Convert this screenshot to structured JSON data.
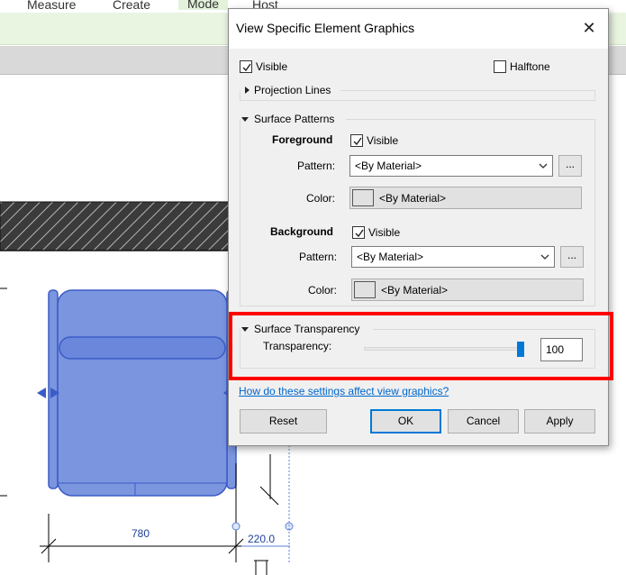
{
  "ribbon": {
    "tabs": [
      "Measure",
      "Create",
      "Mode",
      "Host"
    ],
    "active_tab": "Mode"
  },
  "drawing": {
    "dimension_width": "780",
    "dimension_offset": "220.0"
  },
  "dialog": {
    "title": "View Specific Element Graphics",
    "close_icon": "close-icon",
    "visible_label": "Visible",
    "visible_checked": true,
    "halftone_label": "Halftone",
    "halftone_checked": false,
    "projection_lines_label": "Projection Lines",
    "surface_patterns": {
      "label": "Surface Patterns",
      "foreground": {
        "label": "Foreground",
        "visible_label": "Visible",
        "visible_checked": true,
        "pattern_label": "Pattern:",
        "pattern_value": "<By Material>",
        "browse_label": "...",
        "color_label": "Color:",
        "color_value": "<By Material>"
      },
      "background": {
        "label": "Background",
        "visible_label": "Visible",
        "visible_checked": true,
        "pattern_label": "Pattern:",
        "pattern_value": "<By Material>",
        "browse_label": "...",
        "color_label": "Color:",
        "color_value": "<By Material>"
      }
    },
    "surface_transparency": {
      "label": "Surface Transparency",
      "transparency_label": "Transparency:",
      "value": "100",
      "slider_fraction": 1.0
    },
    "help_link": "How do these settings affect view graphics?",
    "buttons": {
      "reset": "Reset",
      "ok": "OK",
      "cancel": "Cancel",
      "apply": "Apply"
    }
  },
  "colors": {
    "accent": "#0078d7",
    "highlight": "#ff0000",
    "element_fill": "#7b95df",
    "element_stroke": "#3b5cc6",
    "link": "#0066cc"
  }
}
